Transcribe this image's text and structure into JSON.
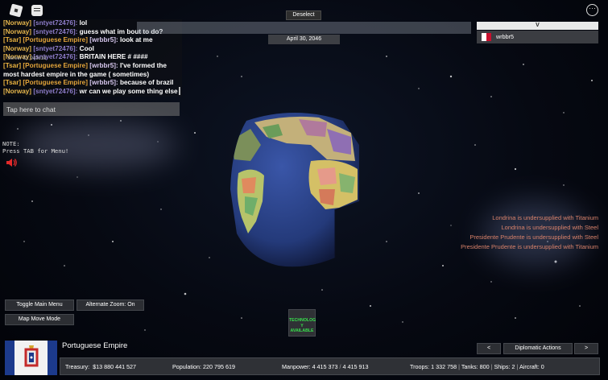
{
  "chat": {
    "lines": [
      {
        "tags": [
          "[Norway]"
        ],
        "name": "[sntyet72476]:",
        "msg": "lol"
      },
      {
        "tags": [
          "[Norway]"
        ],
        "name": "[sntyet72476]:",
        "msg": "guess what im bout to do?"
      },
      {
        "tags": [
          "[Tsar]",
          "[Portuguese Empire]"
        ],
        "name": "[wrbbr5]:",
        "msg": "look at me"
      },
      {
        "tags": [
          "[Norway]"
        ],
        "name": "[sntyet72476]:",
        "msg": "Cool"
      },
      {
        "tags": [
          "[Norway]"
        ],
        "name": "[sntyet72476]:",
        "msg": "BRITAIN HERE # ####"
      },
      {
        "tags": [
          "[Tsar]",
          "[Portuguese Empire]"
        ],
        "name": "[wrbbr5]:",
        "msg": "I've formed the most hardest empire in the game ( sometimes)"
      },
      {
        "tags": [
          "[Tsar]",
          "[Portuguese Empire]"
        ],
        "name": "[wrbbr5]:",
        "msg": "because of brazil"
      },
      {
        "tags": [
          "[Norway]"
        ],
        "name": "[sntyet72476]:",
        "msg": "wr can we play some thing else"
      }
    ],
    "overlay": "Server ID: 943c1d",
    "input_placeholder": "Tap here to chat"
  },
  "note": {
    "line1": "NOTE:",
    "line2": "Press TAB for Menu!"
  },
  "top": {
    "deselect": "Deselect",
    "date": "April 30, 2046"
  },
  "players": {
    "toggle": "V",
    "items": [
      {
        "name": "wrbbr5"
      }
    ]
  },
  "notices": [
    "Londrina is undersupplied with Titanium",
    "Londrina is undersupplied with Steel",
    "Presidente Prudente is undersupplied with Steel",
    "Presidente Prudente is undersupplied with Titanium"
  ],
  "buttons": {
    "toggle_main": "Toggle Main Menu",
    "alt_zoom": "Alternate Zoom: On",
    "map_move": "Map Move Mode",
    "prev": "<",
    "diplomatic": "Diplomatic Actions",
    "next": ">"
  },
  "tech": {
    "line1": "TECHNOLOG",
    "line2": "Y AVAILABLE"
  },
  "country": {
    "name": "Portuguese Empire",
    "treasury_label": "Treasury:",
    "treasury": "$13 880 441 527",
    "population_label": "Population:",
    "population": "220 795 619",
    "manpower_label": "Manpower:",
    "manpower": "4 415 373",
    "manpower_max": "4 415 913",
    "troops_label": "Troops:",
    "troops": "1 332 758",
    "tanks_label": "Tanks:",
    "tanks": "800",
    "ships_label": "Ships:",
    "ships": "2",
    "aircraft_label": "Aircraft:",
    "aircraft": "0"
  },
  "colors": {
    "notice": "#d9826a",
    "tech_text": "#38e04d",
    "ocean": "#243a7a"
  },
  "icons": [
    "roblox-icon",
    "chat-icon",
    "menu-icon",
    "speaker-icon",
    "flag-icon"
  ]
}
